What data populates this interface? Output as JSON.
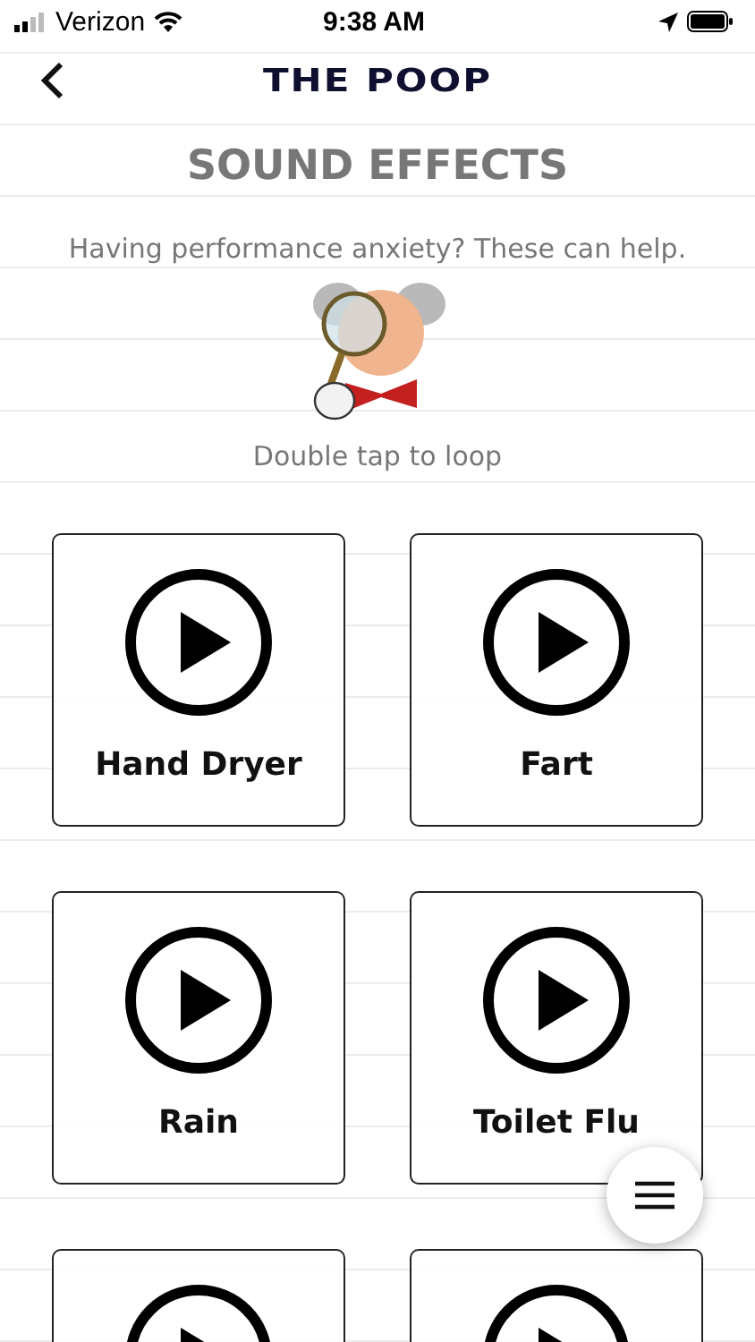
{
  "status_bar": {
    "carrier": "Verizon",
    "time": "9:38 AM"
  },
  "nav": {
    "logo": "THE POOP"
  },
  "title": "SOUND EFFECTS",
  "subtitle": "Having performance anxiety? These can help.",
  "hint": "Double tap to loop",
  "sounds": [
    {
      "kind": "full",
      "label": "Hand Dryer"
    },
    {
      "kind": "full",
      "label": "Fart"
    },
    {
      "kind": "full",
      "label": "Rain"
    },
    {
      "kind": "full",
      "label": "Toilet Flu"
    },
    {
      "kind": "partial"
    },
    {
      "kind": "partial"
    }
  ]
}
